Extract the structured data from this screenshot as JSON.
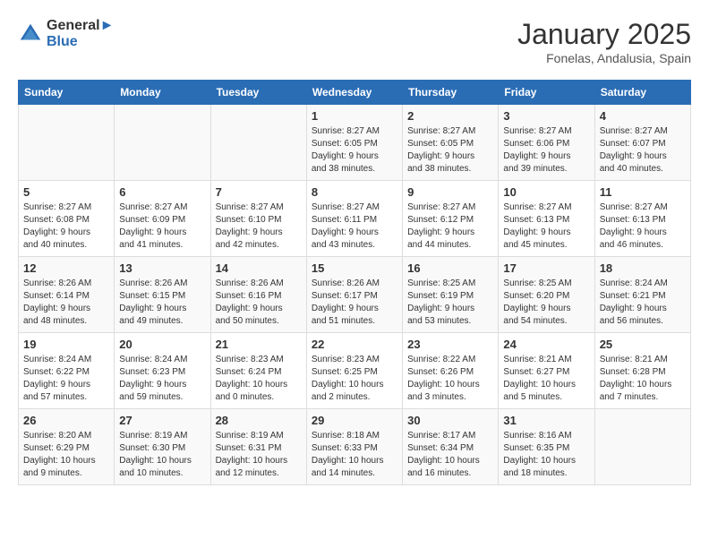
{
  "header": {
    "logo_line1": "General",
    "logo_line2": "Blue",
    "month": "January 2025",
    "location": "Fonelas, Andalusia, Spain"
  },
  "weekdays": [
    "Sunday",
    "Monday",
    "Tuesday",
    "Wednesday",
    "Thursday",
    "Friday",
    "Saturday"
  ],
  "weeks": [
    [
      {
        "day": "",
        "info": ""
      },
      {
        "day": "",
        "info": ""
      },
      {
        "day": "",
        "info": ""
      },
      {
        "day": "1",
        "info": "Sunrise: 8:27 AM\nSunset: 6:05 PM\nDaylight: 9 hours\nand 38 minutes."
      },
      {
        "day": "2",
        "info": "Sunrise: 8:27 AM\nSunset: 6:05 PM\nDaylight: 9 hours\nand 38 minutes."
      },
      {
        "day": "3",
        "info": "Sunrise: 8:27 AM\nSunset: 6:06 PM\nDaylight: 9 hours\nand 39 minutes."
      },
      {
        "day": "4",
        "info": "Sunrise: 8:27 AM\nSunset: 6:07 PM\nDaylight: 9 hours\nand 40 minutes."
      }
    ],
    [
      {
        "day": "5",
        "info": "Sunrise: 8:27 AM\nSunset: 6:08 PM\nDaylight: 9 hours\nand 40 minutes."
      },
      {
        "day": "6",
        "info": "Sunrise: 8:27 AM\nSunset: 6:09 PM\nDaylight: 9 hours\nand 41 minutes."
      },
      {
        "day": "7",
        "info": "Sunrise: 8:27 AM\nSunset: 6:10 PM\nDaylight: 9 hours\nand 42 minutes."
      },
      {
        "day": "8",
        "info": "Sunrise: 8:27 AM\nSunset: 6:11 PM\nDaylight: 9 hours\nand 43 minutes."
      },
      {
        "day": "9",
        "info": "Sunrise: 8:27 AM\nSunset: 6:12 PM\nDaylight: 9 hours\nand 44 minutes."
      },
      {
        "day": "10",
        "info": "Sunrise: 8:27 AM\nSunset: 6:13 PM\nDaylight: 9 hours\nand 45 minutes."
      },
      {
        "day": "11",
        "info": "Sunrise: 8:27 AM\nSunset: 6:13 PM\nDaylight: 9 hours\nand 46 minutes."
      }
    ],
    [
      {
        "day": "12",
        "info": "Sunrise: 8:26 AM\nSunset: 6:14 PM\nDaylight: 9 hours\nand 48 minutes."
      },
      {
        "day": "13",
        "info": "Sunrise: 8:26 AM\nSunset: 6:15 PM\nDaylight: 9 hours\nand 49 minutes."
      },
      {
        "day": "14",
        "info": "Sunrise: 8:26 AM\nSunset: 6:16 PM\nDaylight: 9 hours\nand 50 minutes."
      },
      {
        "day": "15",
        "info": "Sunrise: 8:26 AM\nSunset: 6:17 PM\nDaylight: 9 hours\nand 51 minutes."
      },
      {
        "day": "16",
        "info": "Sunrise: 8:25 AM\nSunset: 6:19 PM\nDaylight: 9 hours\nand 53 minutes."
      },
      {
        "day": "17",
        "info": "Sunrise: 8:25 AM\nSunset: 6:20 PM\nDaylight: 9 hours\nand 54 minutes."
      },
      {
        "day": "18",
        "info": "Sunrise: 8:24 AM\nSunset: 6:21 PM\nDaylight: 9 hours\nand 56 minutes."
      }
    ],
    [
      {
        "day": "19",
        "info": "Sunrise: 8:24 AM\nSunset: 6:22 PM\nDaylight: 9 hours\nand 57 minutes."
      },
      {
        "day": "20",
        "info": "Sunrise: 8:24 AM\nSunset: 6:23 PM\nDaylight: 9 hours\nand 59 minutes."
      },
      {
        "day": "21",
        "info": "Sunrise: 8:23 AM\nSunset: 6:24 PM\nDaylight: 10 hours\nand 0 minutes."
      },
      {
        "day": "22",
        "info": "Sunrise: 8:23 AM\nSunset: 6:25 PM\nDaylight: 10 hours\nand 2 minutes."
      },
      {
        "day": "23",
        "info": "Sunrise: 8:22 AM\nSunset: 6:26 PM\nDaylight: 10 hours\nand 3 minutes."
      },
      {
        "day": "24",
        "info": "Sunrise: 8:21 AM\nSunset: 6:27 PM\nDaylight: 10 hours\nand 5 minutes."
      },
      {
        "day": "25",
        "info": "Sunrise: 8:21 AM\nSunset: 6:28 PM\nDaylight: 10 hours\nand 7 minutes."
      }
    ],
    [
      {
        "day": "26",
        "info": "Sunrise: 8:20 AM\nSunset: 6:29 PM\nDaylight: 10 hours\nand 9 minutes."
      },
      {
        "day": "27",
        "info": "Sunrise: 8:19 AM\nSunset: 6:30 PM\nDaylight: 10 hours\nand 10 minutes."
      },
      {
        "day": "28",
        "info": "Sunrise: 8:19 AM\nSunset: 6:31 PM\nDaylight: 10 hours\nand 12 minutes."
      },
      {
        "day": "29",
        "info": "Sunrise: 8:18 AM\nSunset: 6:33 PM\nDaylight: 10 hours\nand 14 minutes."
      },
      {
        "day": "30",
        "info": "Sunrise: 8:17 AM\nSunset: 6:34 PM\nDaylight: 10 hours\nand 16 minutes."
      },
      {
        "day": "31",
        "info": "Sunrise: 8:16 AM\nSunset: 6:35 PM\nDaylight: 10 hours\nand 18 minutes."
      },
      {
        "day": "",
        "info": ""
      }
    ]
  ]
}
